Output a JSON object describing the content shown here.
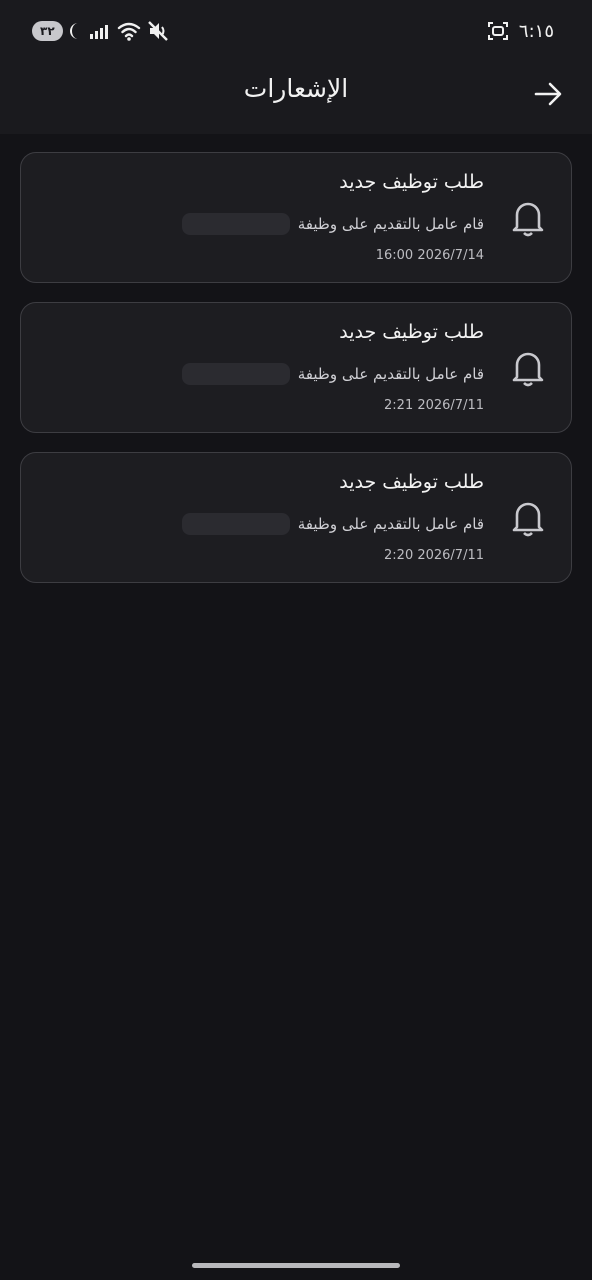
{
  "status_bar": {
    "time": "٦:١٥",
    "battery": "٣٢"
  },
  "header": {
    "title": "الإشعارات",
    "back_icon": "arrow-right-icon"
  },
  "notifications": [
    {
      "title": "طلب توظيف جديد",
      "body": "قام عامل بالتقديم على وظيفة",
      "time": "16:00 2026/7/14",
      "icon": "bell-icon"
    },
    {
      "title": "طلب توظيف جديد",
      "body": "قام عامل بالتقديم على وظيفة",
      "time": "2:21 2026/7/11",
      "icon": "bell-icon"
    },
    {
      "title": "طلب توظيف جديد",
      "body": "قام عامل بالتقديم على وظيفة",
      "time": "2:20 2026/7/11",
      "icon": "bell-icon"
    }
  ]
}
